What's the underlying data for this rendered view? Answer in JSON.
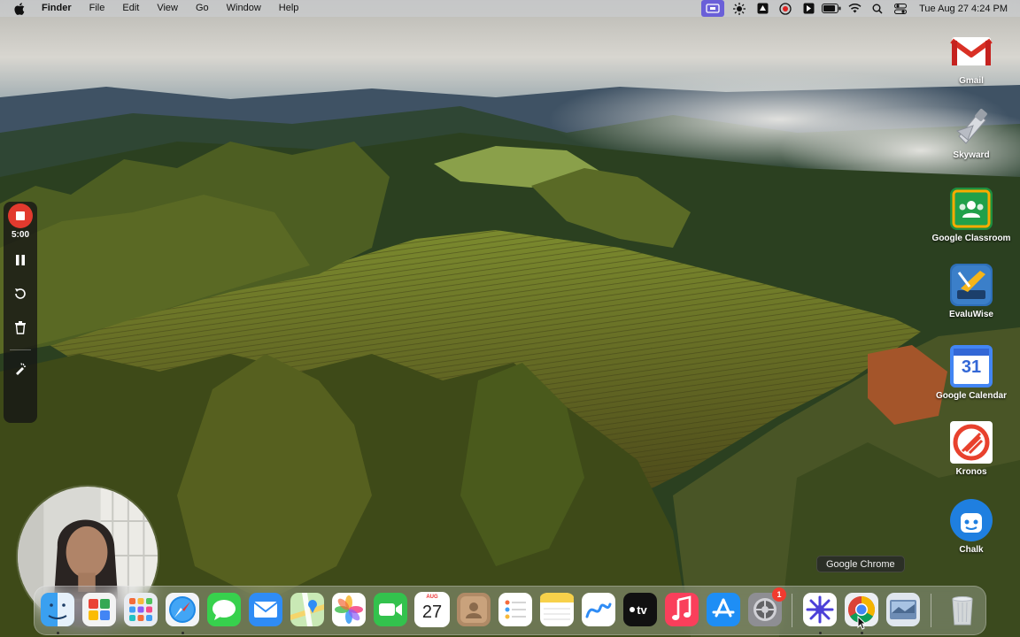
{
  "menubar": {
    "app_name": "Finder",
    "menus": [
      "File",
      "Edit",
      "View",
      "Go",
      "Window",
      "Help"
    ],
    "clock": "Tue Aug 27  4:24 PM",
    "status_icons": [
      "screen-record-icon",
      "brightness-icon",
      "vpn-icon",
      "recording-icon",
      "app-icon",
      "battery-icon",
      "wifi-icon",
      "search-icon",
      "control-center-icon"
    ]
  },
  "desktop_icons": [
    {
      "label": "Gmail",
      "icon": "gmail-icon"
    },
    {
      "label": "Skyward",
      "icon": "skyward-icon"
    },
    {
      "label": "Google Classroom",
      "icon": "google-classroom-icon"
    },
    {
      "label": "EvaluWise",
      "icon": "evaluwise-icon"
    },
    {
      "label": "Google Calendar",
      "icon": "google-calendar-icon",
      "day": "31"
    },
    {
      "label": "Kronos",
      "icon": "kronos-icon"
    },
    {
      "label": "Chalk",
      "icon": "chalk-icon"
    }
  ],
  "recorder": {
    "timer": "5:00",
    "controls": [
      "stop-icon",
      "pause-icon",
      "restart-icon",
      "trash-icon",
      "draw-icon"
    ]
  },
  "tooltip": "Google Chrome",
  "dock": {
    "items": [
      {
        "name": "finder-icon",
        "running": true
      },
      {
        "name": "google-sheets-app-icon",
        "running": false
      },
      {
        "name": "launchpad-icon",
        "running": false
      },
      {
        "name": "safari-icon",
        "running": true
      },
      {
        "name": "messages-icon",
        "running": false
      },
      {
        "name": "mail-icon",
        "running": false
      },
      {
        "name": "maps-icon",
        "running": false
      },
      {
        "name": "photos-icon",
        "running": false
      },
      {
        "name": "facetime-icon",
        "running": false
      },
      {
        "name": "calendar-icon",
        "running": false,
        "month": "AUG",
        "day": "27"
      },
      {
        "name": "contacts-icon",
        "running": false
      },
      {
        "name": "reminders-icon",
        "running": false
      },
      {
        "name": "notes-icon",
        "running": false
      },
      {
        "name": "freeform-icon",
        "running": false
      },
      {
        "name": "apple-tv-icon",
        "running": false,
        "text": "tv"
      },
      {
        "name": "music-icon",
        "running": false
      },
      {
        "name": "app-store-icon",
        "running": false
      },
      {
        "name": "system-settings-icon",
        "running": false,
        "badge": "1"
      },
      {
        "name": "perplexity-icon",
        "running": true
      },
      {
        "name": "google-chrome-icon",
        "running": true
      },
      {
        "name": "preview-icon",
        "running": false
      },
      {
        "name": "trash-icon",
        "running": false
      }
    ]
  },
  "colors": {
    "menubar_bg": "#cdd2d7",
    "record_red": "#e23a2e",
    "badge_red": "#f23b2f"
  }
}
